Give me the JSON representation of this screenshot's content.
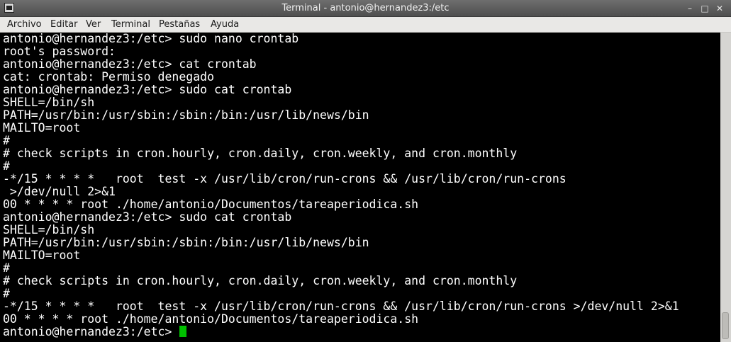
{
  "window": {
    "title": "Terminal - antonio@hernandez3:/etc",
    "controls": {
      "minimize": "–",
      "maximize": "□",
      "close": "✕"
    }
  },
  "menubar": {
    "items": [
      "Archivo",
      "Editar",
      "Ver",
      "Terminal",
      "Pestañas",
      "Ayuda"
    ]
  },
  "terminal": {
    "lines": [
      "antonio@hernandez3:/etc> sudo nano crontab",
      "root's password:",
      "antonio@hernandez3:/etc> cat crontab",
      "cat: crontab: Permiso denegado",
      "antonio@hernandez3:/etc> sudo cat crontab",
      "SHELL=/bin/sh",
      "PATH=/usr/bin:/usr/sbin:/sbin:/bin:/usr/lib/news/bin",
      "MAILTO=root",
      "#",
      "# check scripts in cron.hourly, cron.daily, cron.weekly, and cron.monthly",
      "#",
      "-*/15 * * * *   root  test -x /usr/lib/cron/run-crons && /usr/lib/cron/run-crons",
      " >/dev/null 2>&1",
      "00 * * * * root ./home/antonio/Documentos/tareaperiodica.sh",
      "antonio@hernandez3:/etc> sudo cat crontab",
      "SHELL=/bin/sh",
      "PATH=/usr/bin:/usr/sbin:/sbin:/bin:/usr/lib/news/bin",
      "MAILTO=root",
      "#",
      "# check scripts in cron.hourly, cron.daily, cron.weekly, and cron.monthly",
      "#",
      "-*/15 * * * *   root  test -x /usr/lib/cron/run-crons && /usr/lib/cron/run-crons >/dev/null 2>&1",
      "00 * * * * root ./home/antonio/Documentos/tareaperiodica.sh"
    ],
    "prompt": "antonio@hernandez3:/etc> ",
    "cursor_color": "#00c000"
  }
}
